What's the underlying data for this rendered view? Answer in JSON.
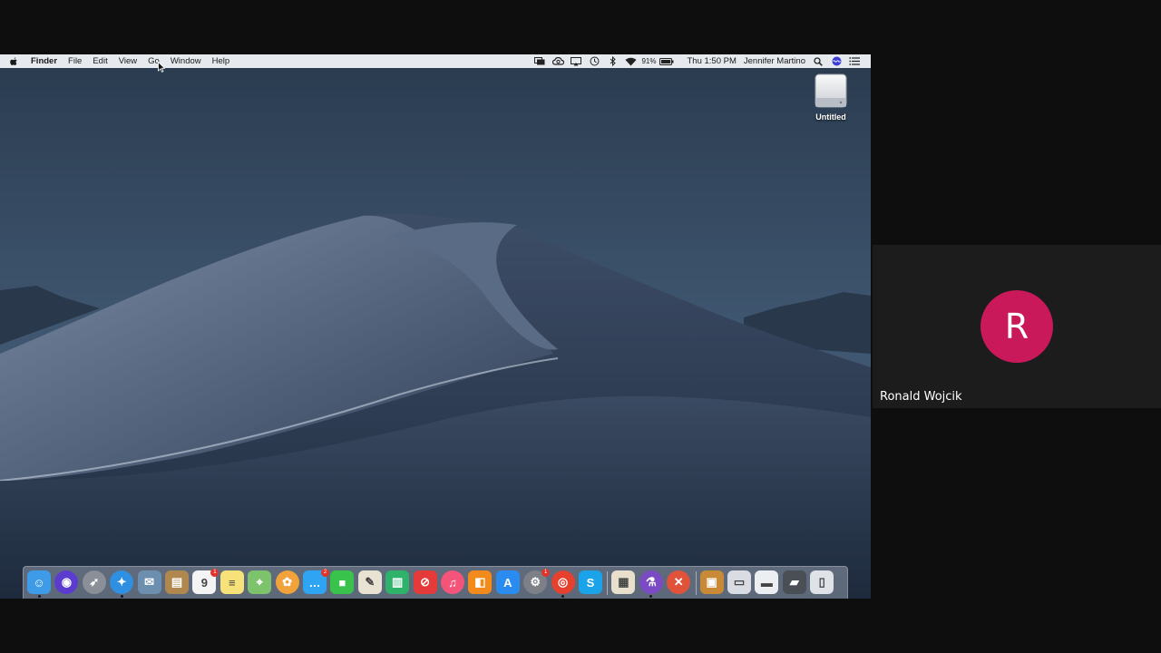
{
  "menubar": {
    "app_name": "Finder",
    "menus": [
      "File",
      "Edit",
      "View",
      "Go",
      "Window",
      "Help"
    ],
    "status_icons": [
      "screen-mirroring-icon",
      "creative-cloud-icon",
      "airplay-icon",
      "time-machine-icon",
      "bluetooth-icon",
      "wifi-icon"
    ],
    "battery_percent": "91%",
    "clock": "Thu 1:50 PM",
    "user_name": "Jennifer Martino"
  },
  "desktop": {
    "drive_label": "Untitled"
  },
  "dock": {
    "apps": [
      {
        "name": "finder",
        "icon": "finder-icon",
        "color": "#3e9be8",
        "running": true
      },
      {
        "name": "siri",
        "icon": "siri-icon",
        "color": "#5b3ccf",
        "running": false
      },
      {
        "name": "launchpad",
        "icon": "rocket-icon",
        "color": "#8a8f98",
        "running": false
      },
      {
        "name": "safari",
        "icon": "compass-icon",
        "color": "#2f8fe0",
        "running": true
      },
      {
        "name": "mail-preview",
        "icon": "stamp-icon",
        "color": "#6c8fb0",
        "running": false
      },
      {
        "name": "contacts",
        "icon": "address-book-icon",
        "color": "#b0884f",
        "running": false
      },
      {
        "name": "calendar",
        "icon": "calendar-icon",
        "color": "#f4f4f4",
        "badge": "1",
        "running": false
      },
      {
        "name": "notes",
        "icon": "notes-icon",
        "color": "#f7e27a",
        "running": false
      },
      {
        "name": "maps",
        "icon": "map-icon",
        "color": "#7cc36b",
        "running": false
      },
      {
        "name": "photos",
        "icon": "photos-flower-icon",
        "color": "#f1a23a",
        "running": false
      },
      {
        "name": "messages",
        "icon": "message-bubble-icon",
        "color": "#2fa4f3",
        "badge": "2",
        "running": false
      },
      {
        "name": "facetime",
        "icon": "video-camera-icon",
        "color": "#39c24c",
        "running": false
      },
      {
        "name": "textedit",
        "icon": "pencil-paper-icon",
        "color": "#e9e3d4",
        "running": false
      },
      {
        "name": "numbers",
        "icon": "bar-chart-icon",
        "color": "#2fb36a",
        "running": false
      },
      {
        "name": "news",
        "icon": "no-entry-icon",
        "color": "#e53a3a",
        "running": false
      },
      {
        "name": "music",
        "icon": "music-note-icon",
        "color": "#f4547a",
        "running": false
      },
      {
        "name": "books",
        "icon": "book-icon",
        "color": "#f28b1b",
        "running": false
      },
      {
        "name": "app-store",
        "icon": "app-store-icon",
        "color": "#2a8cf0",
        "running": false
      },
      {
        "name": "system-preferences",
        "icon": "gear-icon",
        "color": "#7d8087",
        "badge": "1",
        "running": false
      },
      {
        "name": "chrome",
        "icon": "chrome-icon",
        "color": "#e6412e",
        "running": true
      },
      {
        "name": "skype",
        "icon": "skype-icon",
        "color": "#1aa3e8",
        "running": false
      },
      {
        "name": "preview-doc",
        "icon": "document-icon",
        "color": "#e8e0cc",
        "running": false
      },
      {
        "name": "flask-app",
        "icon": "flask-icon",
        "color": "#7b4bc4",
        "running": true
      },
      {
        "name": "remote-app",
        "icon": "x-circle-icon",
        "color": "#e0523a",
        "running": false
      },
      {
        "name": "archive",
        "icon": "box-icon",
        "color": "#c98a37",
        "running": false
      },
      {
        "name": "cards",
        "icon": "cards-icon",
        "color": "#d9dde3",
        "running": false
      },
      {
        "name": "id-card",
        "icon": "id-card-icon",
        "color": "#eceff2",
        "running": false
      },
      {
        "name": "scanner",
        "icon": "scanner-icon",
        "color": "#4a4e55",
        "running": false
      },
      {
        "name": "trash",
        "icon": "trash-icon",
        "color": "#dfe3e8",
        "running": false
      }
    ]
  },
  "participant": {
    "initial": "R",
    "name": "Ronald Wojcik",
    "avatar_color": "#c9195a"
  }
}
